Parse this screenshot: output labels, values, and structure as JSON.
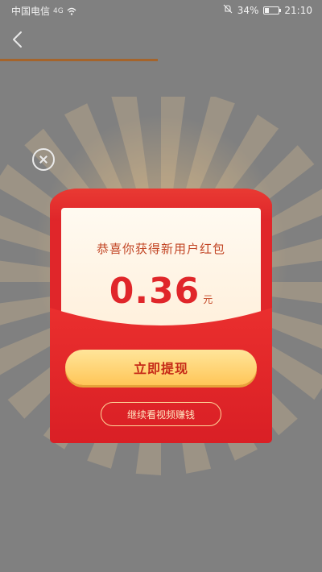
{
  "status_bar": {
    "carrier": "中国电信",
    "signal_label": "4G",
    "battery_percent": "34%",
    "battery_level": 0.34,
    "time": "21:10"
  },
  "navigation": {
    "back_icon": "chevron-left-icon",
    "progress": 0.7
  },
  "popup": {
    "close_icon": "close-icon",
    "title": "恭喜你获得新用户红包",
    "amount": "0.36",
    "unit": "元",
    "primary_button": "立即提现",
    "secondary_button": "继续看视频赚钱"
  },
  "colors": {
    "overlay": "#808080",
    "envelope_red": "#e0262a",
    "button_gold": "#ffc658",
    "progress_brown": "#a5642b"
  }
}
